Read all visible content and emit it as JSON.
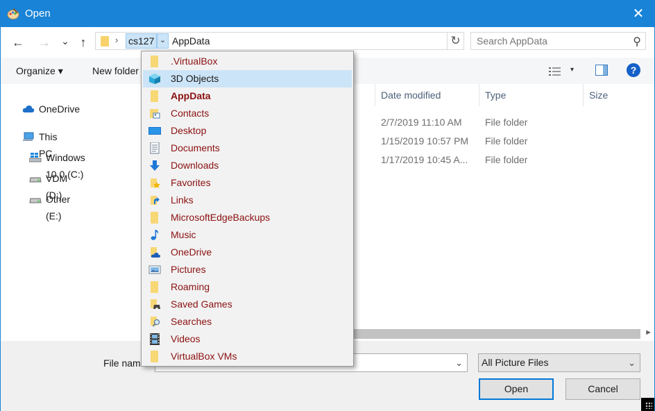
{
  "window": {
    "title": "Open"
  },
  "nav": {
    "back": "←",
    "forward": "→",
    "recent": "⌄",
    "up": "↑",
    "address": {
      "separator": "›",
      "crumbs": [
        "cs127",
        "AppData"
      ],
      "crumb_dropdown": "⌄",
      "refresh": "↻"
    },
    "search": {
      "placeholder": "Search AppData"
    }
  },
  "toolbar": {
    "organize": "Organize ▾",
    "new_folder": "New folder",
    "view_dropdown": "▾",
    "help": "?"
  },
  "sidebar": {
    "items": [
      {
        "label": "OneDrive",
        "icon": "cloud-icon"
      },
      {
        "label": "This PC",
        "icon": "computer-icon"
      },
      {
        "label": "Windows 10.0 (C:)",
        "icon": "windows-drive-icon"
      },
      {
        "label": "VDM (D:)",
        "icon": "drive-icon"
      },
      {
        "label": "Other (E:)",
        "icon": "drive-icon"
      }
    ]
  },
  "file_list": {
    "columns": [
      "Date modified",
      "Type",
      "Size"
    ],
    "rows": [
      {
        "date": "2/7/2019 11:10 AM",
        "type": "File folder"
      },
      {
        "date": "1/15/2019 10:57 PM",
        "type": "File folder"
      },
      {
        "date": "1/17/2019 10:45 A...",
        "type": "File folder"
      }
    ],
    "scroll_right": "►"
  },
  "footer": {
    "file_name_label": "File name:",
    "file_name_value": "",
    "file_name_dropdown": "⌄",
    "file_type": "All Picture Files",
    "file_type_dropdown": "⌄",
    "open": "Open",
    "cancel": "Cancel"
  },
  "dropdown": {
    "items": [
      {
        "label": ".VirtualBox",
        "icon": "folder-icon"
      },
      {
        "label": "3D Objects",
        "icon": "cube-icon",
        "highlighted": true
      },
      {
        "label": "AppData",
        "icon": "folder-icon",
        "bold": true
      },
      {
        "label": "Contacts",
        "icon": "contacts-icon"
      },
      {
        "label": "Desktop",
        "icon": "desktop-icon"
      },
      {
        "label": "Documents",
        "icon": "documents-icon"
      },
      {
        "label": "Downloads",
        "icon": "download-icon"
      },
      {
        "label": "Favorites",
        "icon": "favorites-icon"
      },
      {
        "label": "Links",
        "icon": "links-icon"
      },
      {
        "label": "MicrosoftEdgeBackups",
        "icon": "folder-icon"
      },
      {
        "label": "Music",
        "icon": "music-icon"
      },
      {
        "label": "OneDrive",
        "icon": "onedrive-folder-icon"
      },
      {
        "label": "Pictures",
        "icon": "pictures-icon"
      },
      {
        "label": "Roaming",
        "icon": "folder-icon"
      },
      {
        "label": "Saved Games",
        "icon": "saved-games-icon"
      },
      {
        "label": "Searches",
        "icon": "search-folder-icon"
      },
      {
        "label": "Videos",
        "icon": "videos-icon"
      },
      {
        "label": "VirtualBox VMs",
        "icon": "folder-icon"
      }
    ]
  },
  "colors": {
    "titlebar": "#1883d7",
    "dropdown_text": "#8b1010",
    "highlight": "#cce4f7",
    "folder": "#f8d775"
  }
}
